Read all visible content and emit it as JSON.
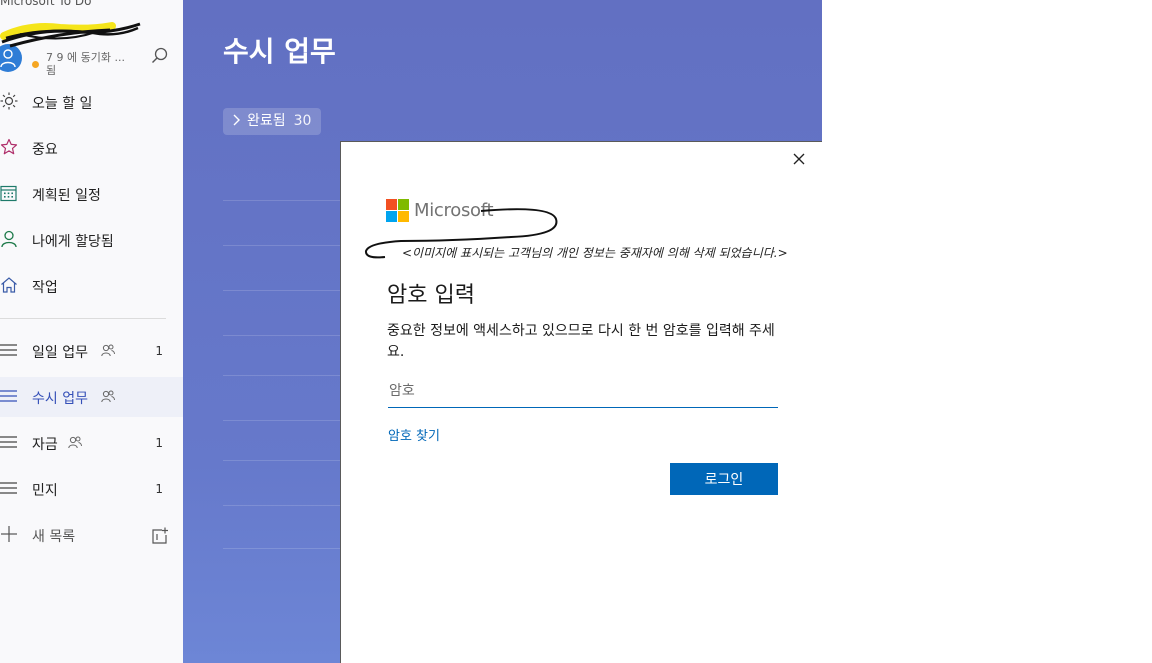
{
  "app": {
    "title": "Microsoft To Do"
  },
  "account": {
    "sync_status": "7 9 에 동기화 ... 됨"
  },
  "colors": {
    "accent": "#3550b8",
    "list_background": "#6679cb",
    "ms_blue": "#0067b8",
    "sync_dot": "#f5a623"
  },
  "sidebar": {
    "smart_lists": [
      {
        "label": "오늘 할 일",
        "icon": "sun-icon"
      },
      {
        "label": "중요",
        "icon": "star-icon"
      },
      {
        "label": "계획된 일정",
        "icon": "calendar-icon"
      },
      {
        "label": "나에게 할당됨",
        "icon": "person-icon"
      },
      {
        "label": "작업",
        "icon": "home-icon"
      }
    ],
    "lists": [
      {
        "label": "일일 업무",
        "shared": true,
        "count": "1"
      },
      {
        "label": "수시 업무",
        "shared": true,
        "count": ""
      },
      {
        "label": "자금",
        "shared": true,
        "count": "1"
      },
      {
        "label": "민지",
        "shared": false,
        "count": "1"
      }
    ],
    "new_list_label": "새 목록"
  },
  "main": {
    "title": "수시 업무",
    "completed_label": "완료됨",
    "completed_count": "30"
  },
  "dialog": {
    "brand": "Microsoft",
    "privacy_note": "<이미지에 표시되는 고객님의 개인 정보는 중재자에 의해 삭제 되었습니다.>",
    "title": "암호 입력",
    "description": "중요한 정보에 액세스하고 있으므로 다시 한 번 암호를 입력해 주세요.",
    "password_placeholder": "암호",
    "forgot_password": "암호 찾기",
    "signin_button": "로그인"
  }
}
